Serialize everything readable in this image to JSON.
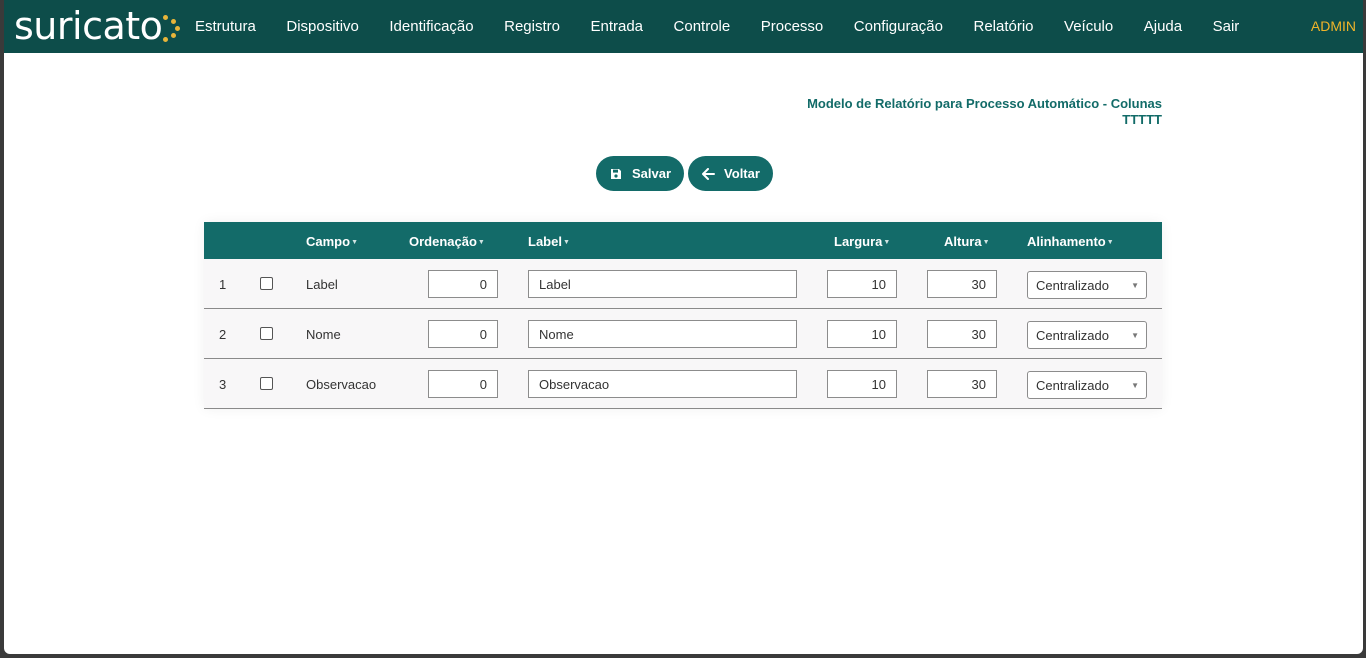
{
  "brand": {
    "name": "suricato",
    "dot_color": "#e8b53a"
  },
  "nav": {
    "items": [
      "Estrutura",
      "Dispositivo",
      "Identificação",
      "Registro",
      "Entrada",
      "Controle",
      "Processo",
      "Configuração",
      "Relatório",
      "Veículo",
      "Ajuda",
      "Sair"
    ],
    "user": "ADMIN"
  },
  "page": {
    "title": "Modelo de Relatório para Processo Automático - Colunas",
    "subtitle": "TTTTT"
  },
  "actions": {
    "save": "Salvar",
    "back": "Voltar"
  },
  "table": {
    "headers": {
      "campo": "Campo",
      "ordenacao": "Ordenação",
      "label": "Label",
      "largura": "Largura",
      "altura": "Altura",
      "alinhamento": "Alinhamento"
    },
    "rows": [
      {
        "num": "1",
        "campo": "Label",
        "ordenacao": "0",
        "label": "Label",
        "largura": "10",
        "altura": "30",
        "alinhamento": "Centralizado"
      },
      {
        "num": "2",
        "campo": "Nome",
        "ordenacao": "0",
        "label": "Nome",
        "largura": "10",
        "altura": "30",
        "alinhamento": "Centralizado"
      },
      {
        "num": "3",
        "campo": "Observacao",
        "ordenacao": "0",
        "label": "Observacao",
        "largura": "10",
        "altura": "30",
        "alinhamento": "Centralizado"
      }
    ]
  },
  "colors": {
    "navbar": "#0d4d4a",
    "accent": "#136b69",
    "user": "#f0b429"
  }
}
